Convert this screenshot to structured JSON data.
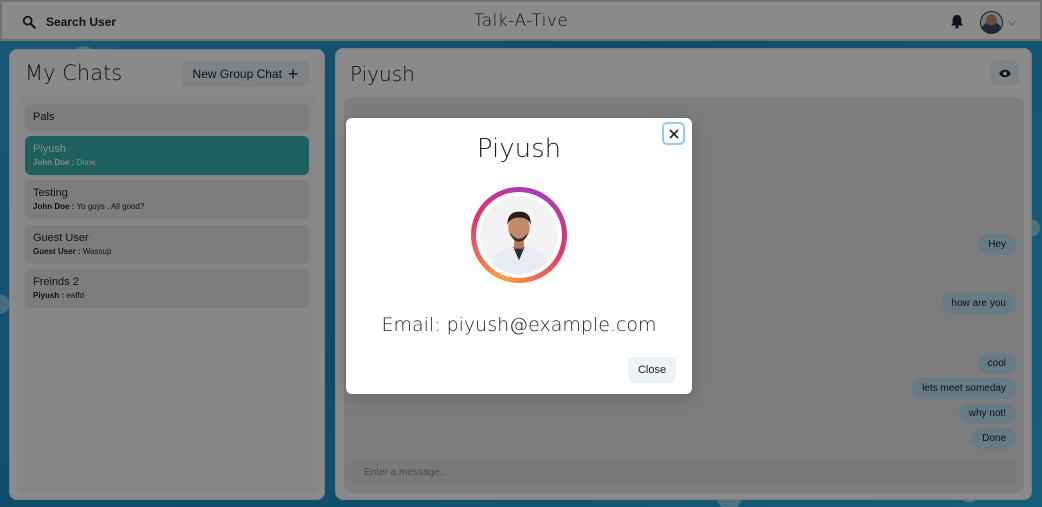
{
  "header": {
    "search_label": "Search User",
    "app_title": "Talk-A-Tive",
    "icons": {
      "search": "search-icon",
      "bell": "bell-icon",
      "chevron": "chevron-down-icon"
    }
  },
  "left": {
    "title": "My Chats",
    "new_group_label": "New Group Chat",
    "chats": [
      {
        "name": "Pals",
        "sender": "",
        "message": ""
      },
      {
        "name": "Piyush",
        "sender": "John Doe : ",
        "message": "Done"
      },
      {
        "name": "Testing",
        "sender": "John Doe : ",
        "message": "Yo guys , All good?"
      },
      {
        "name": "Guest User",
        "sender": "Guest User : ",
        "message": "Wassup"
      },
      {
        "name": "Freinds 2",
        "sender": "Piyush : ",
        "message": "eaffd"
      }
    ]
  },
  "right": {
    "title": "Piyush",
    "messages": [
      "Hey",
      "how are you",
      "cool",
      "lets meet someday",
      "why not!",
      "Done"
    ],
    "input_placeholder": "Enter a message.."
  },
  "modal": {
    "title": "Piyush",
    "email": "Email: piyush@example.com",
    "close_label": "Close"
  },
  "colors": {
    "accent": "#38B2AC",
    "message_bubble": "#BEE3F8",
    "focus_ring": "#90CDF4"
  }
}
